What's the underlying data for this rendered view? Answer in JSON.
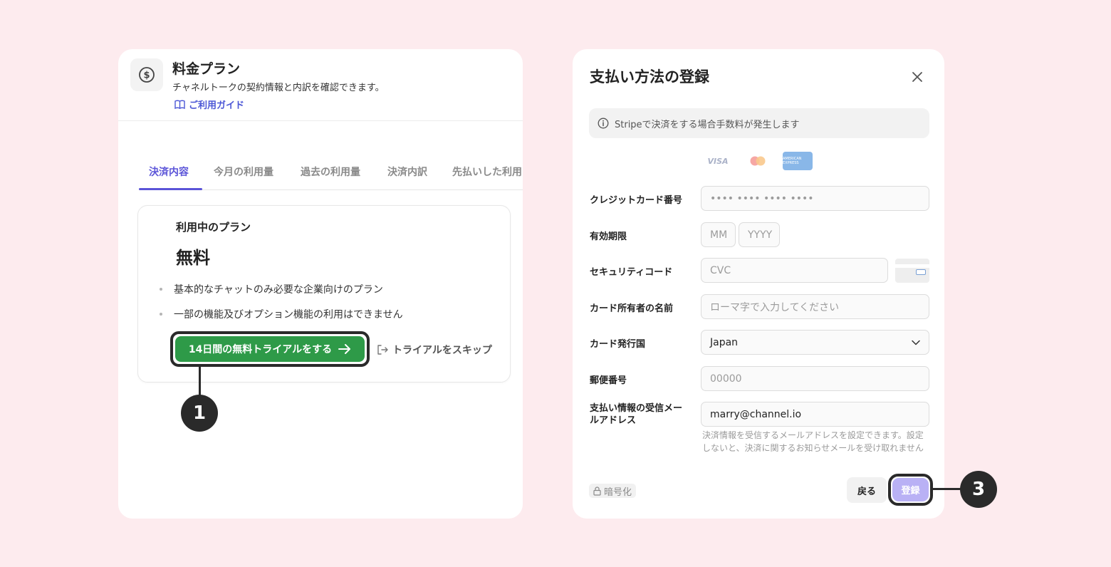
{
  "left_card": {
    "title": "料金プラン",
    "subtitle": "チャネルトークの契約情報と内訳を確認できます。",
    "guide_link": "ご利用ガイド",
    "tabs": [
      "決済内容",
      "今月の利用量",
      "過去の利用量",
      "決済内訳",
      "先払いした利用"
    ],
    "active_tab": "決済内容",
    "plan": {
      "label": "利用中のプラン",
      "name": "無料",
      "bullets": [
        "基本的なチャットのみ必要な企業向けのプラン",
        "一部の機能及びオプション機能の利用はできません"
      ],
      "trial_button": "14日間の無料トライアルをする",
      "skip_link": "トライアルをスキップ"
    }
  },
  "callouts": {
    "first": "1",
    "third": "3"
  },
  "modal": {
    "title": "支払い方法の登録",
    "notice": "Stripeで決済をする場合手数料が発生します",
    "brands": {
      "visa": "VISA",
      "amex": "AMERICAN EXPRESS"
    },
    "fields": {
      "card_number": {
        "label": "クレジットカード番号",
        "placeholder": "•••• •••• •••• ••••"
      },
      "expiry": {
        "label": "有効期限",
        "month_placeholder": "MM",
        "year_placeholder": "YYYY"
      },
      "security_code": {
        "label": "セキュリティコード",
        "placeholder": "CVC"
      },
      "holder_name": {
        "label": "カード所有者の名前",
        "placeholder": "ローマ字で入力してください"
      },
      "country": {
        "label": "カード発行国",
        "value": "Japan"
      },
      "postal_code": {
        "label": "郵便番号",
        "placeholder": "00000"
      },
      "email": {
        "label_line1": "支払い情報の受信メー",
        "label_line2": "ルアドレス",
        "value": "marry@channel.io",
        "helper": "決済情報を受信するメールアドレスを設定できます。設定しないと、決済に関するお知らせメールを受け取れません"
      }
    },
    "encrypted_badge": "暗号化",
    "back_button": "戻る",
    "register_button": "登録"
  },
  "colors": {
    "background": "#fdebee",
    "accent": "#5b54d8",
    "trial_green": "#2e9a48",
    "register_purple": "#b9b1f5",
    "callout": "#2a2a2a"
  }
}
